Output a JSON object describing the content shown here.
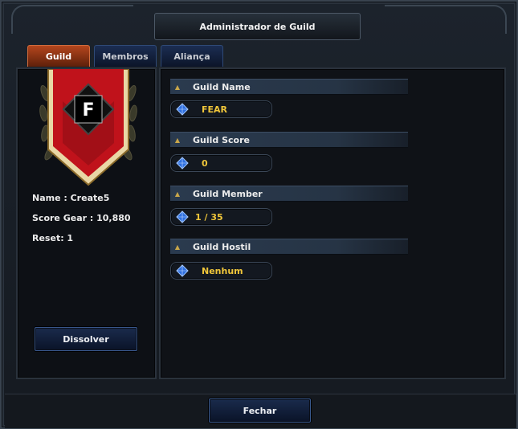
{
  "window": {
    "title": "Administrador de Guild"
  },
  "tabs": [
    {
      "label": "Guild",
      "active": true
    },
    {
      "label": "Membros",
      "active": false
    },
    {
      "label": "Aliança",
      "active": false
    }
  ],
  "guild_mark": {
    "letter": "F",
    "icon": "guild-banner-icon"
  },
  "info": {
    "name": "Name : Create5",
    "score_gear": "Score Gear : 10,880",
    "reset": "Reset: 1"
  },
  "buttons": {
    "dissolve": "Dissolver",
    "close": "Fechar"
  },
  "fields": [
    {
      "label": "Guild Name",
      "value": "FEAR"
    },
    {
      "label": "Guild Score",
      "value": "0"
    },
    {
      "label": "Guild Member",
      "value": "1 / 35"
    },
    {
      "label": "Guild Hostil",
      "value": "Nenhum"
    }
  ],
  "colors": {
    "active_tab": "#b4461d",
    "value_text": "#f0c63a",
    "banner_red": "#c0121b",
    "banner_gold": "#e9d7a6"
  }
}
